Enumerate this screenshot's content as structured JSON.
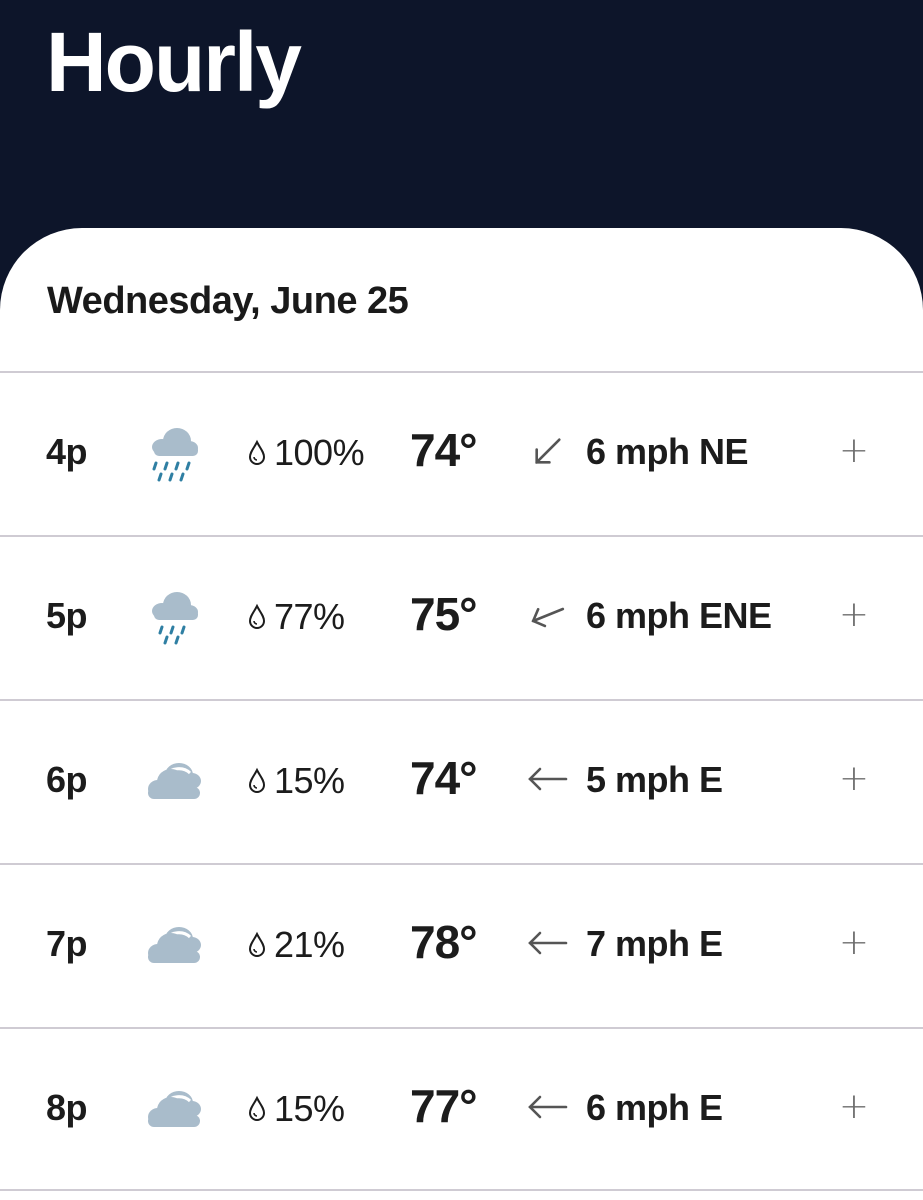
{
  "page": {
    "title": "Hourly"
  },
  "day": {
    "heading": "Wednesday, June 25"
  },
  "hours": [
    {
      "time": "4p",
      "condition_icon": "rain-heavy-icon",
      "precip": "100%",
      "temp": "74°",
      "wind_dir": "NE",
      "wind": "6 mph NE",
      "expand": "+"
    },
    {
      "time": "5p",
      "condition_icon": "rain-icon",
      "precip": "77%",
      "temp": "75°",
      "wind_dir": "ENE",
      "wind": "6 mph ENE",
      "expand": "+"
    },
    {
      "time": "6p",
      "condition_icon": "cloudy-icon",
      "precip": "15%",
      "temp": "74°",
      "wind_dir": "E",
      "wind": "5 mph E",
      "expand": "+"
    },
    {
      "time": "7p",
      "condition_icon": "cloudy-icon",
      "precip": "21%",
      "temp": "78°",
      "wind_dir": "E",
      "wind": "7 mph E",
      "expand": "+"
    },
    {
      "time": "8p",
      "condition_icon": "cloudy-icon",
      "precip": "15%",
      "temp": "77°",
      "wind_dir": "E",
      "wind": "6 mph E",
      "expand": "+"
    }
  ],
  "colors": {
    "header_bg": "#0d152a",
    "rain_drop": "#2f7fa3",
    "cloud": "#a9bccb",
    "divider": "#cfcbd3"
  }
}
